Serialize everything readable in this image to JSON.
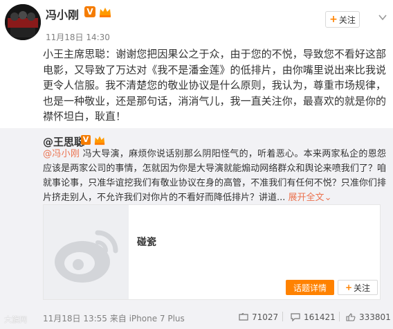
{
  "post": {
    "author": "冯小刚",
    "timestamp": "11月18日 14:30",
    "follow_label": "关注",
    "text": "小王主席思聪：谢谢您把因果公之于众，由于您的不悦，导致您不看好这部电影，又导致了万达对《我不是潘金莲》的低排片，由你嘴里说出来比我说更令人信服。我不清楚您的敬业协议是什么原则，我认为，尊重市场规律，也是一种敬业，还是那句话，消消气儿，我一直关注你，最喜欢的就是你的襟怀坦白，耿直！"
  },
  "repost": {
    "author": "@王思聪",
    "mention": "@冯小刚",
    "text": " 冯大导演，麻烦你说话别那么阴阳怪气的，听着恶心。本来两家私企的恩怨应该是两家公司的事情，怎就因为你是大导演就能煽动网络群众和舆论来喷我们了？咱就事论事，只准华谊挖我们有敬业协议在身的高管，不准我们有任何不悦？只准你们排片挤走别人，不允许我们对你片的不看好而降低排片？",
    "tail": "讲道... ",
    "more_label": "展开全文",
    "more_chevron": "⌄",
    "card": {
      "title": "碰瓷",
      "topic_button": "话题详情",
      "follow_label": "关注"
    },
    "footer": "11月18日 13:55 来自 iPhone 7 Plus",
    "stats": {
      "reposts": "71027",
      "comments": "161421",
      "likes": "333801"
    }
  },
  "watermark": "大旗网"
}
